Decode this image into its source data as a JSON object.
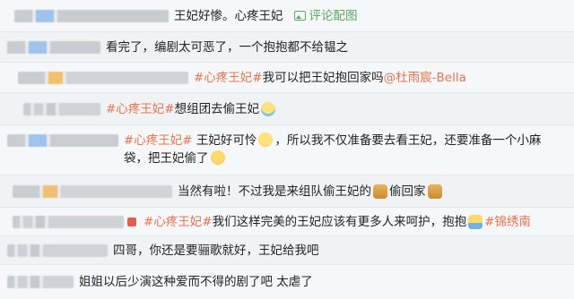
{
  "comments": [
    {
      "text": "王妃好惨。心疼王妃",
      "pic_link": "评论配图"
    },
    {
      "text": "看完了，编剧太可恶了，一个抱抱都不给韫之"
    },
    {
      "tag": "#心疼王妃#",
      "text": " 我可以把王妃抱回家吗",
      "mention": "@杜雨宸-Bella"
    },
    {
      "tag": "#心疼王妃#",
      "text": " 想组团去偷王妃"
    },
    {
      "tag": "#心疼王妃#",
      "text1": " 王妃好可怜",
      "text2": "，所以我不仅准备要去看王妃，还要准备一个小麻",
      "text3": "袋，把王妃偷了"
    },
    {
      "text1": "当然有啦！不过我是来组队偷王妃的",
      "text2": "偷回家"
    },
    {
      "tag": "#心疼王妃#",
      "text": " 我们这样完美的王妃应该有更多人来呵护，抱抱",
      "tag2": "#锦绣南"
    },
    {
      "text": "四哥，你还是要骊歌就好，王妃给我吧"
    },
    {
      "text": "姐姐以后少演这种爱而不得的剧了吧  太虐了"
    }
  ],
  "icons": [
    "picture-icon",
    "cry-emoji",
    "worried-emoji",
    "smirk-emoji",
    "doge-emoji",
    "hug-emoji"
  ]
}
